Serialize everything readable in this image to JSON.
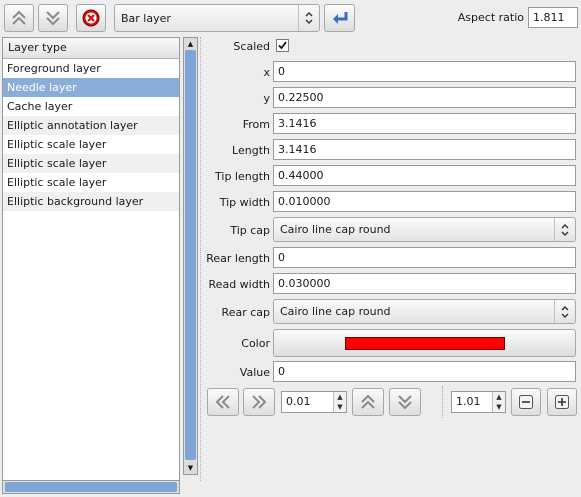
{
  "toolbar": {
    "move_up_icon": "double-chevron-up-icon",
    "move_down_icon": "double-chevron-down-icon",
    "delete_icon": "red-circle-x-icon",
    "layer_kind": "Bar layer",
    "add_icon": "return-arrow-icon",
    "aspect_label": "Aspect ratio",
    "aspect_value": "1.811"
  },
  "layers": {
    "header": "Layer type",
    "items": [
      {
        "label": "Foreground layer"
      },
      {
        "label": "Needle layer"
      },
      {
        "label": "Cache layer"
      },
      {
        "label": "Elliptic annotation layer"
      },
      {
        "label": "Elliptic scale layer"
      },
      {
        "label": "Elliptic scale layer"
      },
      {
        "label": "Elliptic scale layer"
      },
      {
        "label": "Elliptic background layer"
      }
    ],
    "selected_index": 1
  },
  "props": {
    "scaled_label": "Scaled",
    "scaled_checked": true,
    "x_label": "x",
    "x_value": "0",
    "y_label": "y",
    "y_value": "0.22500",
    "from_label": "From",
    "from_value": "3.1416",
    "length_label": "Length",
    "length_value": "3.1416",
    "tip_length_label": "Tip length",
    "tip_length_value": "0.44000",
    "tip_width_label": "Tip width",
    "tip_width_value": "0.010000",
    "tip_cap_label": "Tip cap",
    "tip_cap_value": "Cairo line cap round",
    "rear_length_label": "Rear length",
    "rear_length_value": "0",
    "read_width_label": "Read width",
    "read_width_value": "0.030000",
    "rear_cap_label": "Rear cap",
    "rear_cap_value": "Cairo line cap round",
    "color_label": "Color",
    "color_value": "#ff0000",
    "value_label": "Value",
    "value_value": "0"
  },
  "controls": {
    "step_value": "0.01",
    "factor_value": "1.01"
  }
}
